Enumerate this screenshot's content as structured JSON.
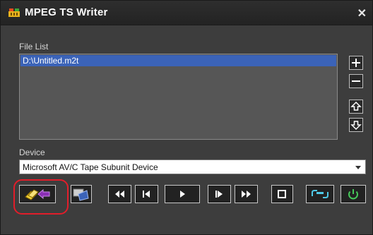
{
  "window": {
    "title": "MPEG TS Writer"
  },
  "icons": {
    "app": "film-app-icon",
    "close": "close-icon",
    "add": "plus-icon",
    "remove": "minus-icon",
    "move_up": "arrow-up-icon",
    "move_down": "arrow-down-icon",
    "export": "export-to-device-icon",
    "capture": "capture-icon",
    "rewind": "rewind-icon",
    "step_back": "step-back-icon",
    "play": "play-icon",
    "step_forward": "step-forward-icon",
    "fast_forward": "fast-forward-icon",
    "stop": "stop-icon",
    "connect": "connect-icon",
    "power": "power-icon"
  },
  "file_list": {
    "label": "File List",
    "items": [
      "D:\\Untitled.m2t"
    ],
    "selected_index": 0
  },
  "device": {
    "label": "Device",
    "selected": "Microsoft AV/C Tape Subunit Device"
  },
  "colors": {
    "selection": "#3b63b8",
    "highlight_ring": "#e21d2a",
    "accent_cyan": "#4fc9e8",
    "accent_green": "#46c85a",
    "accent_purple": "#8a2fb5",
    "accent_yellow": "#f2d23a"
  }
}
